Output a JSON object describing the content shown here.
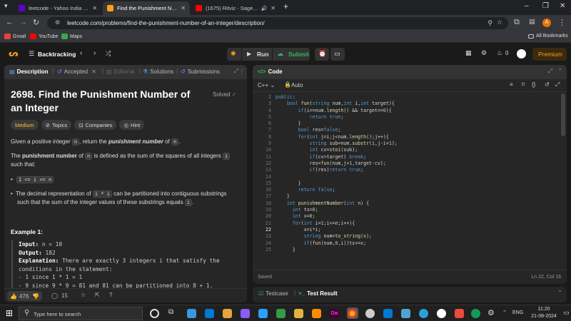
{
  "browser": {
    "tabs": [
      {
        "title": "leetcode - Yahoo India Search R",
        "color": "#6001d2",
        "active": false
      },
      {
        "title": "Find the Punishment Number o",
        "color": "#ffa116",
        "active": true
      },
      {
        "title": "(1675) Ritviz - Sage (Official",
        "color": "#ff0000",
        "active": false
      }
    ],
    "new_tab": "+",
    "url": "leetcode.com/problems/find-the-punishment-number-of-an-integer/description/",
    "profile_initial": "A",
    "bookmarks": [
      {
        "label": "Gmail"
      },
      {
        "label": "YouTube"
      },
      {
        "label": "Maps"
      }
    ],
    "all_bookmarks": "All Bookmarks"
  },
  "header": {
    "list_title": "Backtracking",
    "run": "Run",
    "submit": "Submit",
    "streak": "0",
    "premium": "Premium"
  },
  "left": {
    "tabs": [
      "Description",
      "Accepted",
      "Editorial",
      "Solutions",
      "Submissions"
    ],
    "title": "2698. Find the Punishment Number of an Integer",
    "solved": "Solved",
    "difficulty": "Medium",
    "chips": [
      "Topics",
      "Companies",
      "Hint"
    ],
    "p1a": "Given a positive integer ",
    "p1code": "n",
    "p1b": ", return the ",
    "p1em": "punishment number",
    "p1c": " of ",
    "p1code2": "n",
    "p1d": ".",
    "p2a": "The ",
    "p2b": "punishment number",
    "p2c": " of ",
    "p2code": "n",
    "p2d": " is defined as the sum of the squares of all integers ",
    "p2code2": "i",
    "p2e": " such that:",
    "bullet1": "1 <= i <= n",
    "bullet2a": "The decimal representation of ",
    "bullet2code": "i * i",
    "bullet2b": " can be partitioned into contiguous substrings such that the sum of the integer values of these substrings equals ",
    "bullet2code2": "i",
    "bullet2c": ".",
    "example_title": "Example 1:",
    "input_label": "Input:",
    "input_val": " n = 10",
    "output_label": "Output:",
    "output_val": " 182",
    "expl_label": "Explanation:",
    "expl_text": " There are exactly 3 integers i that satisfy the",
    "expl_line2": "conditions in the statement:",
    "expl_line3": "- 1 since 1 * 1 = 1",
    "expl_line4": "- 9 since 9 * 9 = 81 and 81 can be partitioned into 8 + 1.",
    "likes": "476",
    "comments": "15"
  },
  "right": {
    "title": "Code",
    "language": "C++",
    "mode": "Auto",
    "status": "Saved",
    "cursor": "Ln 22, Col 16",
    "line_numbers": [
      "2",
      "3",
      "4",
      "5",
      "6",
      "7",
      "8",
      "9",
      "10",
      "11",
      "12",
      "13",
      "14",
      "15",
      "16",
      "17",
      "18",
      "19",
      "20",
      "21",
      "22",
      "23",
      "24",
      "25"
    ],
    "bottom_tabs": [
      "Testcase",
      "Test Result"
    ]
  },
  "taskbar": {
    "search_placeholder": "Type here to search",
    "lang": "ENG",
    "time": "11:20",
    "date": "21-08-2024"
  }
}
